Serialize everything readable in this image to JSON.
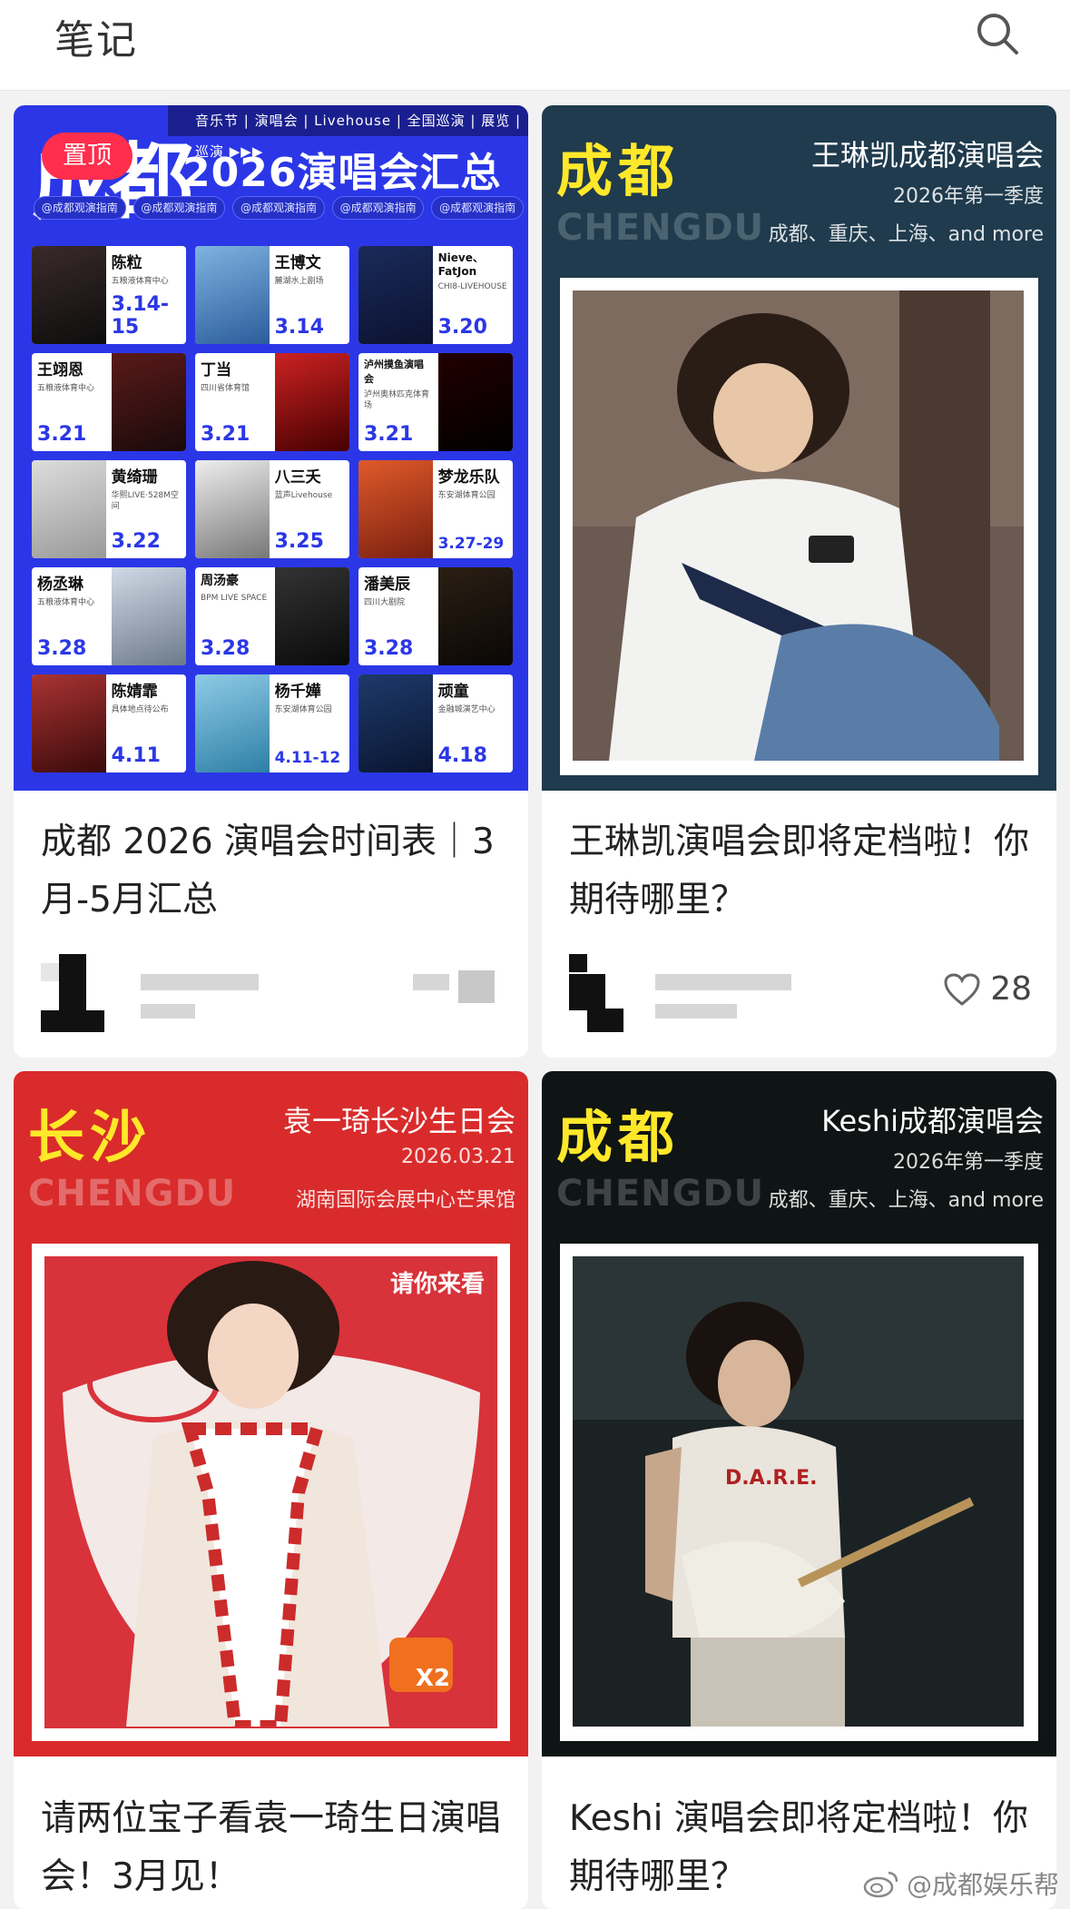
{
  "header": {
    "title": "笔记",
    "search_icon": "search-icon"
  },
  "cards": [
    {
      "pinned_label": "置顶",
      "poster": {
        "band": "音乐节 | 演唱会 | Livehouse | 全国巡演 | 展览 | 巡演 ▶▶▶",
        "city": "成都",
        "headline": "2026演唱会汇总",
        "handles": [
          "@成都观演指南",
          "@成都观演指南",
          "@成都观演指南",
          "@成都观演指南",
          "@成都观演指南"
        ],
        "tiles": [
          {
            "name": "陈粒",
            "venue": "五粮液体育中心",
            "date": "3.14-15"
          },
          {
            "name": "王博文",
            "venue": "麓湖水上剧场",
            "date": "3.14"
          },
          {
            "name": "Nieve、FatJon",
            "venue": "CHI8-LIVEHOUSE",
            "date": "3.20"
          },
          {
            "name": "王翊恩",
            "venue": "五粮液体育中心",
            "date": "3.21"
          },
          {
            "name": "丁当",
            "venue": "四川省体育馆",
            "date": "3.21"
          },
          {
            "name": "泸州摸鱼演唱会",
            "venue": "泸州奥林匹克体育场",
            "date": "3.21"
          },
          {
            "name": "黄绮珊",
            "venue": "华熙LIVE·528M空间",
            "date": "3.22"
          },
          {
            "name": "八三夭",
            "venue": "蓝声Livehouse",
            "date": "3.25"
          },
          {
            "name": "梦龙乐队",
            "venue": "东安湖体育公园",
            "date": "3.27-29"
          },
          {
            "name": "杨丞琳",
            "venue": "五粮液体育中心",
            "date": "3.28"
          },
          {
            "name": "周汤豪",
            "venue": "BPM LIVE SPACE",
            "date": "3.28"
          },
          {
            "name": "潘美辰",
            "venue": "四川大剧院",
            "date": "3.28"
          },
          {
            "name": "陈婧霏",
            "venue": "具体地点待公布",
            "date": "4.11"
          },
          {
            "name": "杨千嬅",
            "venue": "东安湖体育公园",
            "date": "4.11-12"
          },
          {
            "name": "顽童",
            "venue": "金融城演艺中心",
            "date": "4.18"
          }
        ]
      },
      "title": "成都 2026 演唱会时间表｜3月-5月汇总",
      "likes": ""
    },
    {
      "poster": {
        "city": "成都",
        "pinyin": "CHENGDU",
        "title": "王琳凯成都演唱会",
        "sub1": "2026年第一季度",
        "sub2": "成都、重庆、上海、and more"
      },
      "title": "王琳凯演唱会即将定档啦！你期待哪里？",
      "likes": "28"
    },
    {
      "poster": {
        "city": "长沙",
        "pinyin": "CHENGDU",
        "title": "袁一琦长沙生日会",
        "sub1": "2026.03.21",
        "sub2": "湖南国际会展中心芒果馆",
        "invite": "请你来看",
        "badge": "X2"
      },
      "title": "请两位宝子看袁一琦生日演唱会！3月见！"
    },
    {
      "poster": {
        "city": "成都",
        "pinyin": "CHENGDU",
        "title": "Keshi成都演唱会",
        "sub1": "2026年第一季度",
        "sub2": "成都、重庆、上海、and more",
        "shirt": "D.A.R.E."
      },
      "title": "Keshi 演唱会即将定档啦！你期待哪里？"
    }
  ],
  "watermark": "@成都娱乐帮"
}
